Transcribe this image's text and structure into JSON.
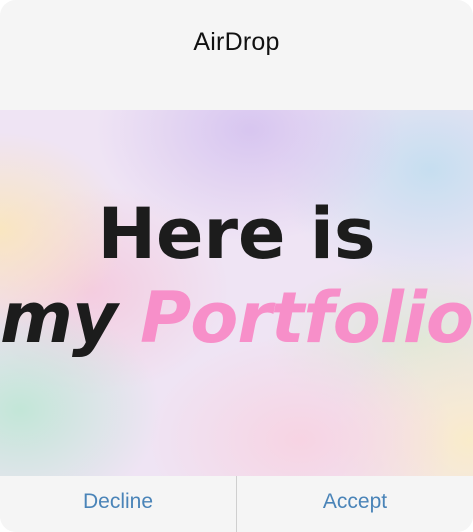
{
  "dialog": {
    "title": "AirDrop"
  },
  "preview": {
    "line1": "Here is",
    "line2_word1": "my",
    "line2_word2": "Portfolio",
    "accent_color": "#f78fc9"
  },
  "actions": {
    "decline_label": "Decline",
    "accept_label": "Accept",
    "label_color": "#4a84b8"
  }
}
